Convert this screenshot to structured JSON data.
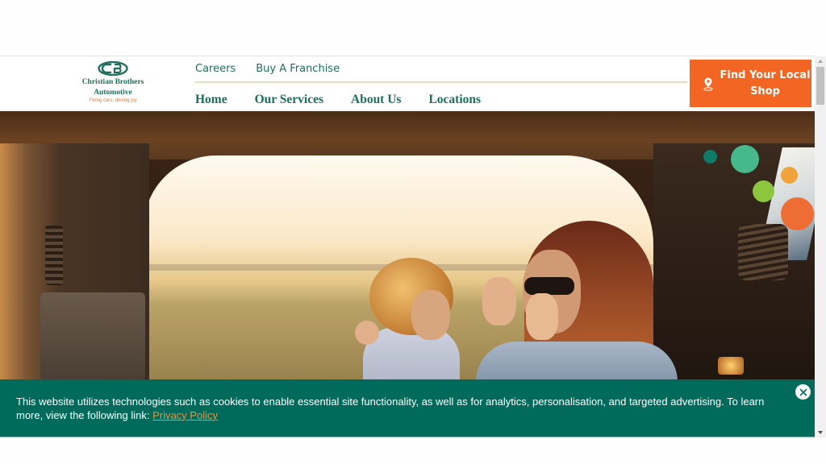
{
  "header": {
    "logo": {
      "name_line1": "Christian Brothers",
      "name_line2": "Automotive",
      "tagline": "Fixing cars, driving joy",
      "brand_color": "#1e6e5c"
    },
    "utility_nav": [
      {
        "label": "Careers"
      },
      {
        "label": "Buy A Franchise"
      }
    ],
    "main_nav": [
      {
        "label": "Home"
      },
      {
        "label": "Our Services"
      },
      {
        "label": "About Us"
      },
      {
        "label": "Locations"
      }
    ],
    "cta": {
      "label": "Find Your Local Shop",
      "icon": "map-pin-icon",
      "color": "#f26522"
    }
  },
  "hero": {
    "image_description": "Mother and child high-fiving in the open trunk of a car at sunset",
    "decorative_dots": [
      "#0f7a66",
      "#46b88c",
      "#eea43a",
      "#8cc63e",
      "#ee6d35"
    ]
  },
  "cookie_banner": {
    "message": "This website utilizes technologies such as cookies to enable essential site functionality, as well as for analytics, personalisation, and targeted advertising. To learn more, view the following link: ",
    "link_label": "Privacy Policy",
    "close_icon": "close-icon",
    "background": "#006b5b"
  }
}
